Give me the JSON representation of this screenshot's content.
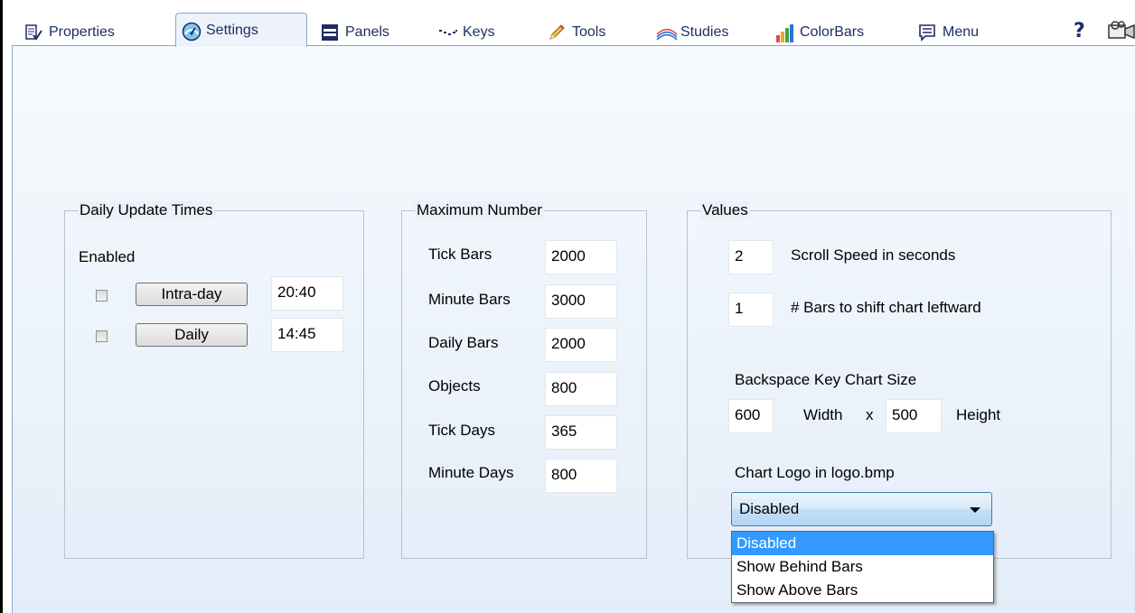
{
  "tabs": [
    {
      "label": "Properties"
    },
    {
      "label": "Settings"
    },
    {
      "label": "Panels"
    },
    {
      "label": "Keys"
    },
    {
      "label": "Tools"
    },
    {
      "label": "Studies"
    },
    {
      "label": "ColorBars"
    },
    {
      "label": "Menu"
    }
  ],
  "help_label": "?",
  "daily_update": {
    "title": "Daily Update Times",
    "enabled_label": "Enabled",
    "rows": [
      {
        "button": "Intra-day",
        "time": "20:40",
        "checked": false
      },
      {
        "button": "Daily",
        "time": "14:45",
        "checked": false
      }
    ]
  },
  "max_number": {
    "title": "Maximum Number",
    "rows": [
      {
        "label": "Tick Bars",
        "value": "2000"
      },
      {
        "label": "Minute Bars",
        "value": "3000"
      },
      {
        "label": "Daily Bars",
        "value": "2000"
      },
      {
        "label": "Objects",
        "value": "800"
      },
      {
        "label": "Tick Days",
        "value": "365"
      },
      {
        "label": "Minute Days",
        "value": "800"
      }
    ]
  },
  "values": {
    "title": "Values",
    "scroll_speed": {
      "value": "2",
      "label": "Scroll Speed in seconds"
    },
    "bars_shift": {
      "value": "1",
      "label": "# Bars to shift chart leftward"
    },
    "backspace_label": "Backspace Key Chart Size",
    "width_value": "600",
    "width_label": "Width",
    "x_label": "x",
    "height_value": "500",
    "height_label": "Height",
    "logo_label": "Chart Logo in logo.bmp",
    "logo_selected": "Disabled",
    "logo_options": [
      "Disabled",
      "Show Behind Bars",
      "Show Above Bars"
    ]
  }
}
